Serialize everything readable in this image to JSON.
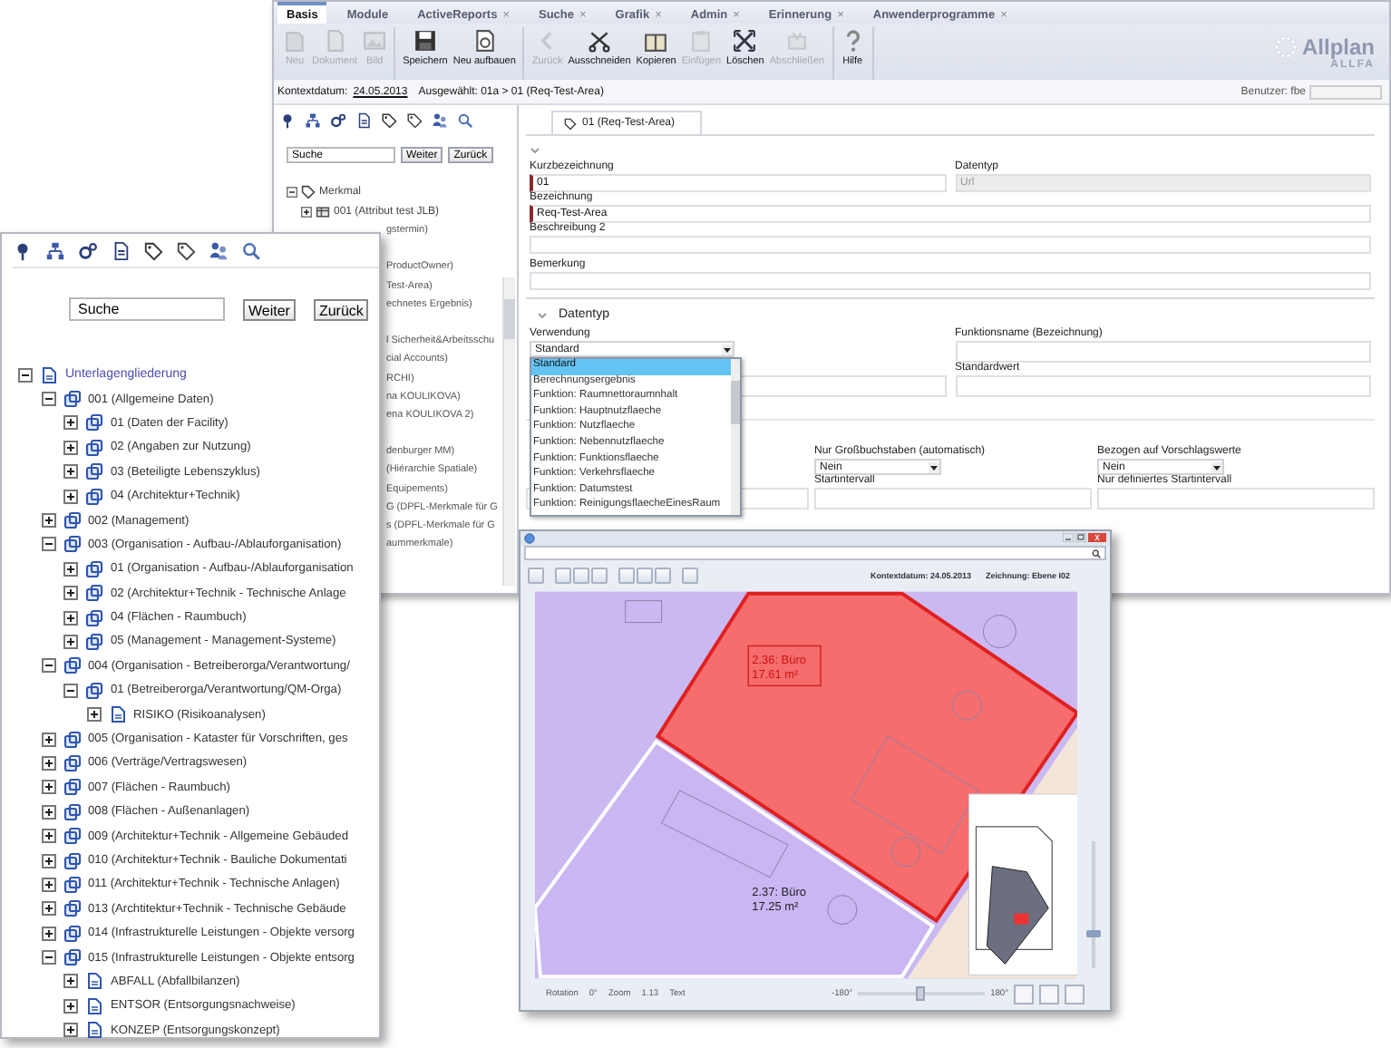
{
  "main_window": {
    "tabs": [
      {
        "label": "Basis",
        "selected": true
      },
      {
        "label": "Module",
        "selected": false
      },
      {
        "label": "ActiveReports",
        "selected": false,
        "close": "×"
      },
      {
        "label": "Suche",
        "selected": false,
        "close": "×"
      },
      {
        "label": "Grafik",
        "selected": false,
        "close": "×"
      },
      {
        "label": "Admin",
        "selected": false,
        "close": "×"
      },
      {
        "label": "Erinnerung",
        "selected": false,
        "close": "×"
      },
      {
        "label": "Anwenderprogramme",
        "selected": false,
        "close": "×"
      }
    ],
    "toolbar": [
      [
        {
          "kind": "new",
          "label": "Neu",
          "disabled": true
        },
        {
          "kind": "document",
          "label": "Dokument",
          "disabled": true
        },
        {
          "kind": "image",
          "label": "Bild",
          "disabled": true
        }
      ],
      [
        {
          "kind": "save",
          "label": "Speichern",
          "disabled": false
        },
        {
          "kind": "rebuild",
          "label": "Neu aufbauen",
          "disabled": false
        }
      ],
      [
        {
          "kind": "back",
          "label": "Zurück",
          "disabled": true
        },
        {
          "kind": "cut",
          "label": "Ausschneiden",
          "disabled": false
        },
        {
          "kind": "copy",
          "label": "Kopieren",
          "disabled": false
        },
        {
          "kind": "paste",
          "label": "Einfügen",
          "disabled": true
        },
        {
          "kind": "delete",
          "label": "Löschen",
          "disabled": false
        },
        {
          "kind": "finish",
          "label": "Abschließen",
          "disabled": true
        }
      ],
      [
        {
          "kind": "help",
          "label": "Hilfe",
          "disabled": false
        }
      ]
    ],
    "logo": {
      "name": "Allplan",
      "product": "ALLFA"
    },
    "context": {
      "date_label": "Kontextdatum:",
      "date": "24.05.2013",
      "selection": "Ausgewählt: 01a > 01 (Req-Test-Area)",
      "user": "Benutzer: fbe"
    },
    "left_panel": {
      "search": {
        "value": "Suche"
      },
      "buttons": [
        "Weiter",
        "Zurück"
      ],
      "tree": [
        {
          "label": "Merkmal",
          "kind": "feature",
          "expanded": true,
          "children": [
            {
              "label": "001 (Attribut test JLB)",
              "kind": "attribute",
              "expanded": false
            }
          ]
        }
      ],
      "hidden_tree_fragments": [
        [
          "gstermin)"
        ],
        [
          "ProductOwner)",
          "Test-Area)",
          "echnetes Ergebnis)"
        ],
        [
          "l Sicherheit&Arbeitsschu",
          "cial Accounts)",
          "RCHI)",
          "na KOULIKOVA)",
          "ena KOULIKOVA 2)"
        ],
        [
          "denburger MM)",
          "(Hiérarchie Spatiale)",
          "Equipements)",
          "G (DPFL-Merkmale für G",
          "s (DPFL-Merkmale für G",
          "aummerkmale)"
        ]
      ]
    },
    "form": {
      "tab": "01 (Req-Test-Area)",
      "short_name": {
        "label": "Kurzbezeichnung",
        "value": "01",
        "required": true,
        "disabled": false
      },
      "data_type": {
        "label": "Datentyp",
        "value": "Url",
        "required": false,
        "disabled": true
      },
      "name": {
        "label": "Bezeichnung",
        "value": "Req-Test-Area",
        "required": true,
        "disabled": false
      },
      "description_2": {
        "label": "Beschreibung 2",
        "required": false
      },
      "remark": {
        "label": "Bemerkung",
        "required": false
      },
      "datatype_section": {
        "title": "Datentyp",
        "usage": {
          "label": "Verwendung",
          "value": "Standard",
          "open": true,
          "options": [
            {
              "label": "Standard",
              "selected": true
            },
            {
              "label": "Berechnungsergebnis",
              "selected": false
            },
            {
              "label": "Funktion: Raumnettoraumnhalt",
              "selected": false
            },
            {
              "label": "Funktion: Hauptnutzflaeche",
              "selected": false
            },
            {
              "label": "Funktion: Nutzflaeche",
              "selected": false
            },
            {
              "label": "Funktion: Nebennutzflaeche",
              "selected": false
            },
            {
              "label": "Funktion: Funktionsflaeche",
              "selected": false
            },
            {
              "label": "Funktion: Verkehrsflaeche",
              "selected": false
            },
            {
              "label": "Funktion: Datumstest",
              "selected": false
            },
            {
              "label": "Funktion: ReinigungsflaecheEinesRaum",
              "selected": false
            }
          ]
        },
        "function_name": {
          "label": "Funktionsname (Bezeichnung)"
        },
        "default_value": {
          "label": "Standardwert"
        },
        "uppercase": {
          "label": "Nur Großbuchstaben (automatisch)",
          "value": "Nein"
        },
        "related": {
          "label": "Bezogen auf Vorschlagswerte",
          "value": "Nein"
        },
        "start_interval": {
          "label": "Startintervall"
        },
        "defined_start": {
          "label": "Nur definiertes Startintervall"
        }
      }
    }
  },
  "tree_window": {
    "search": {
      "value": "Suche"
    },
    "buttons": [
      "Weiter",
      "Zurück"
    ],
    "tree": [
      {
        "label": "Unterlagengliederung",
        "kind": "root",
        "expanded": true,
        "children": [
          {
            "label": "001 (Allgemeine Daten)",
            "kind": "group",
            "expanded": true,
            "children": [
              {
                "label": "01 (Daten der Facility)",
                "kind": "group",
                "expanded": false
              },
              {
                "label": "02 (Angaben zur Nutzung)",
                "kind": "group",
                "expanded": false
              },
              {
                "label": "03 (Beteiligte Lebenszyklus)",
                "kind": "group",
                "expanded": false
              },
              {
                "label": "04 (Architektur+Technik)",
                "kind": "group",
                "expanded": false
              }
            ]
          },
          {
            "label": "002 (Management)",
            "kind": "group",
            "expanded": false
          },
          {
            "label": "003 (Organisation - Aufbau-/Ablauforganisation)",
            "kind": "group",
            "expanded": true,
            "children": [
              {
                "label": "01 (Organisation - Aufbau-/Ablauforganisation",
                "kind": "group",
                "expanded": false
              },
              {
                "label": "02 (Architektur+Technik - Technische Anlage",
                "kind": "group",
                "expanded": false
              },
              {
                "label": "04 (Flächen - Raumbuch)",
                "kind": "group",
                "expanded": false
              },
              {
                "label": "05 (Management - Management-Systeme)",
                "kind": "group",
                "expanded": false
              }
            ]
          },
          {
            "label": "004 (Organisation - Betreiberorga/Verantwortung/",
            "kind": "group",
            "expanded": true,
            "children": [
              {
                "label": "01 (Betreiberorga/Verantwortung/QM-Orga)",
                "kind": "group",
                "expanded": true,
                "children": [
                  {
                    "label": "RISIKO (Risikoanalysen)",
                    "kind": "document",
                    "expanded": false
                  }
                ]
              }
            ]
          },
          {
            "label": "005 (Organisation - Kataster für Vorschriften, ges",
            "kind": "group",
            "expanded": false
          },
          {
            "label": "006 (Verträge/Vertragswesen)",
            "kind": "group",
            "expanded": false
          },
          {
            "label": "007 (Flächen - Raumbuch)",
            "kind": "group",
            "expanded": false
          },
          {
            "label": "008 (Flächen - Außenanlagen)",
            "kind": "group",
            "expanded": false
          },
          {
            "label": "009 (Architektur+Technik - Allgemeine Gebäuded",
            "kind": "group",
            "expanded": false
          },
          {
            "label": "010 (Architektur+Technik - Bauliche Dokumentati",
            "kind": "group",
            "expanded": false
          },
          {
            "label": "011 (Architektur+Technik - Technische Anlagen)",
            "kind": "group",
            "expanded": false
          },
          {
            "label": "013 (Archtitektur+Technik - Technische Gebäude",
            "kind": "group",
            "expanded": false
          },
          {
            "label": "014 (Infrastrukturelle Leistungen - Objekte versorg",
            "kind": "group",
            "expanded": false
          },
          {
            "label": "015 (Infrastrukturelle Leistungen - Objekte entsorg",
            "kind": "group",
            "expanded": true,
            "children": [
              {
                "label": "ABFALL (Abfallbilanzen)",
                "kind": "document",
                "expanded": false
              },
              {
                "label": "ENTSOR (Entsorgungsnachweise)",
                "kind": "document",
                "expanded": false
              },
              {
                "label": "KONZEP (Entsorgungskonzept)",
                "kind": "document",
                "expanded": false
              }
            ]
          }
        ]
      }
    ]
  },
  "map_window": {
    "info": [
      "Kontextdatum: 24.05.2013",
      "Zeichnung: Ebene I02"
    ],
    "rooms": [
      {
        "name": "2.36: Büro",
        "area": "17.61 m²",
        "selected": true
      },
      {
        "name": "2.37: Büro",
        "area": "17.25 m²",
        "selected": false
      }
    ],
    "status": [
      {
        "label": "Rotation",
        "value": "0°"
      },
      {
        "label": "Zoom",
        "value": "1.13"
      },
      {
        "label": "Text"
      }
    ],
    "rotation": {
      "min": "-180°",
      "max": "180°",
      "level": 0.5
    },
    "zoom_slider": {
      "level": 0.25
    }
  }
}
